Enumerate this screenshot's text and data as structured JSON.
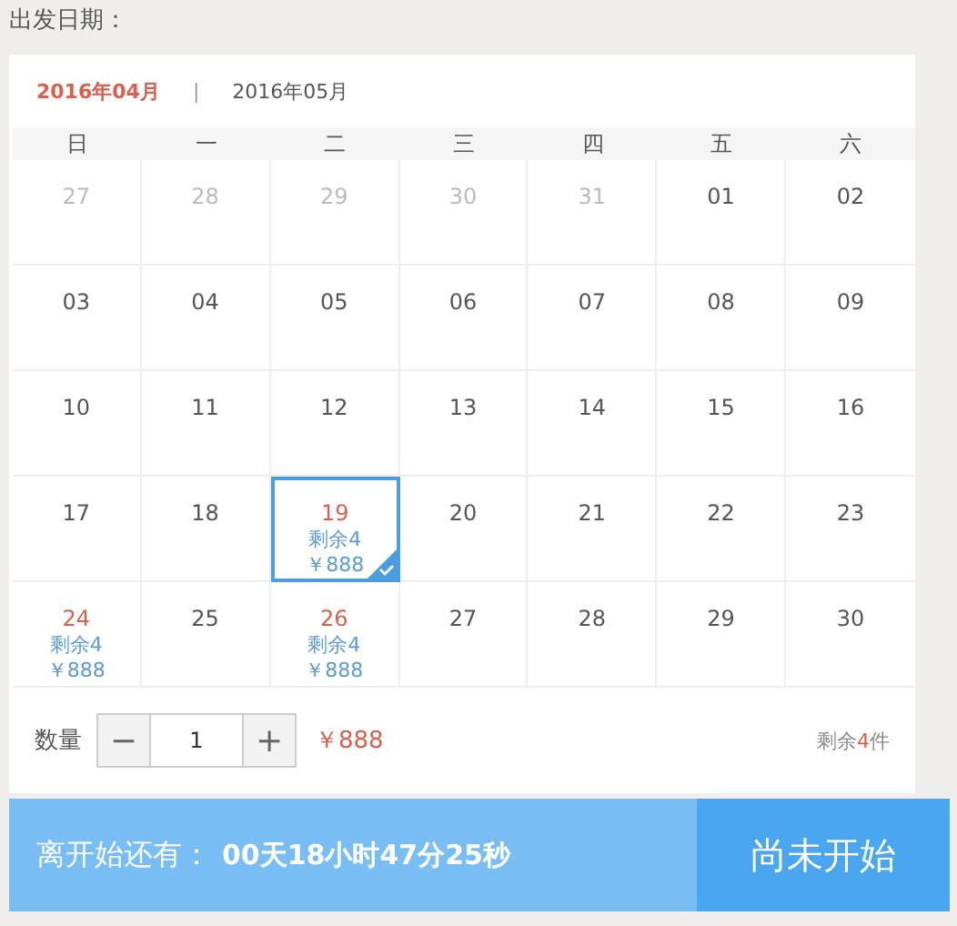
{
  "label": "出发日期：",
  "months": [
    {
      "label": "2016年04月",
      "selected": true
    },
    {
      "label": "2016年05月",
      "selected": false
    }
  ],
  "separator": "|",
  "weekdays": [
    "日",
    "一",
    "二",
    "三",
    "四",
    "五",
    "六"
  ],
  "days": [
    {
      "date": "27",
      "outside": true
    },
    {
      "date": "28",
      "outside": true
    },
    {
      "date": "29",
      "outside": true
    },
    {
      "date": "30",
      "outside": true
    },
    {
      "date": "31",
      "outside": true
    },
    {
      "date": "01"
    },
    {
      "date": "02"
    },
    {
      "date": "03"
    },
    {
      "date": "04"
    },
    {
      "date": "05"
    },
    {
      "date": "06"
    },
    {
      "date": "07"
    },
    {
      "date": "08"
    },
    {
      "date": "09"
    },
    {
      "date": "10"
    },
    {
      "date": "11"
    },
    {
      "date": "12"
    },
    {
      "date": "13"
    },
    {
      "date": "14"
    },
    {
      "date": "15"
    },
    {
      "date": "16"
    },
    {
      "date": "17"
    },
    {
      "date": "18"
    },
    {
      "date": "19",
      "available": true,
      "stock": "剩余4",
      "price": "￥888",
      "selected": true
    },
    {
      "date": "20"
    },
    {
      "date": "21"
    },
    {
      "date": "22"
    },
    {
      "date": "23"
    },
    {
      "date": "24",
      "available": true,
      "stock": "剩余4",
      "price": "￥888",
      "selected": false
    },
    {
      "date": "25"
    },
    {
      "date": "26",
      "available": true,
      "stock": "剩余4",
      "price": "￥888",
      "selected": false
    },
    {
      "date": "27"
    },
    {
      "date": "28"
    },
    {
      "date": "29"
    },
    {
      "date": "30"
    }
  ],
  "quantity": {
    "label": "数量",
    "minus": "−",
    "value": "1",
    "plus": "+",
    "price": "￥888"
  },
  "remaining": {
    "prefix": "剩余",
    "count": "4",
    "suffix": "件"
  },
  "countdown": {
    "label": "离开始还有：",
    "value": "00天18小时47分25秒"
  },
  "action_button": "尚未开始"
}
